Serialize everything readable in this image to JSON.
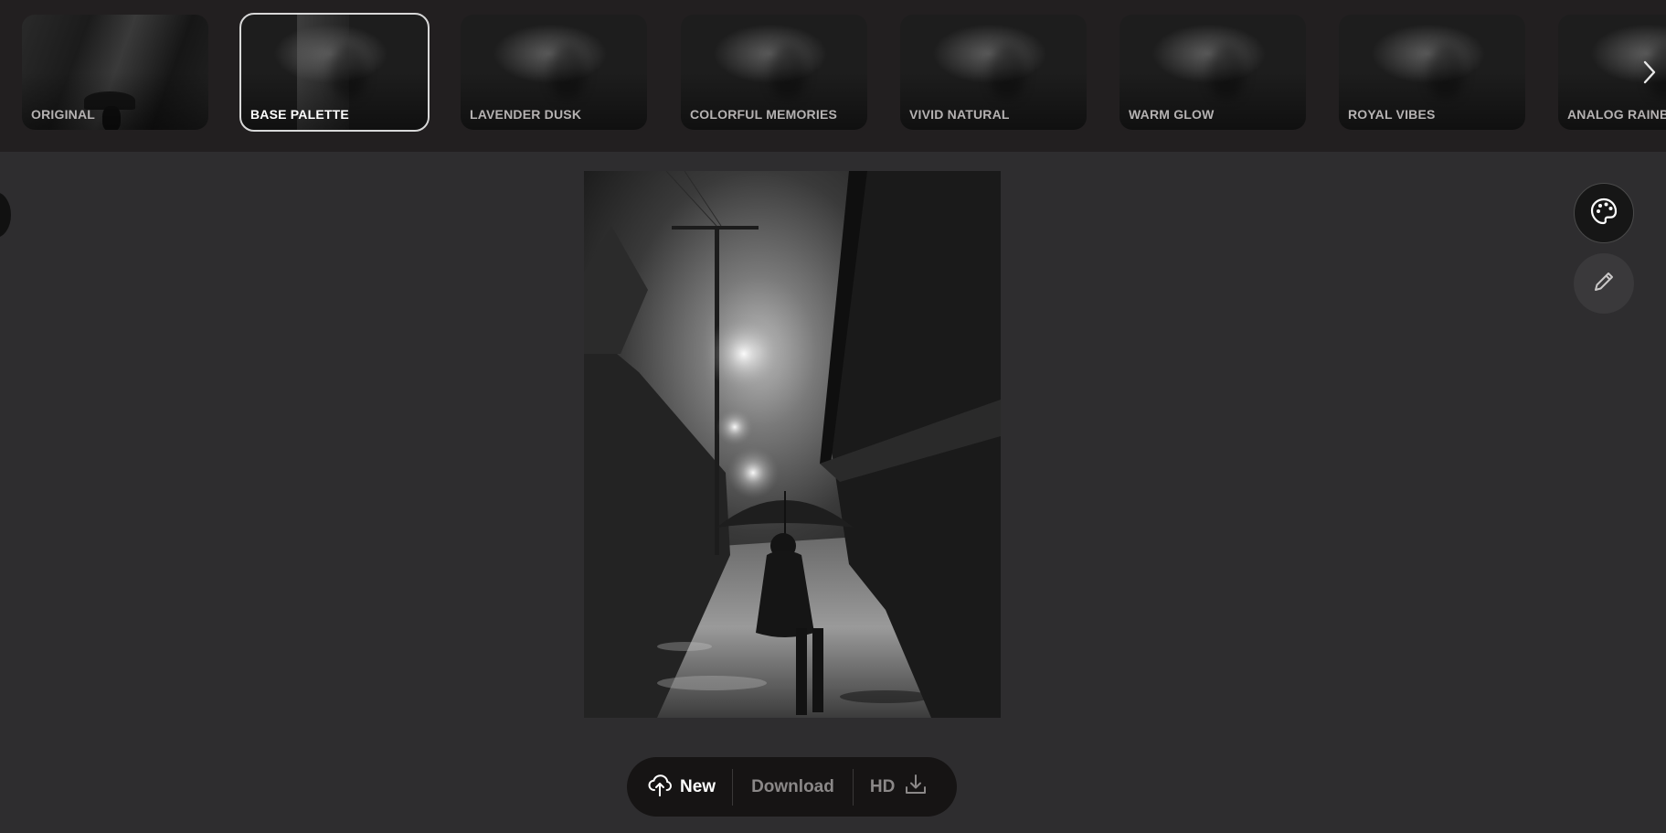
{
  "filters": [
    {
      "label": "ORIGINAL",
      "active": false
    },
    {
      "label": "BASE PALETTE",
      "active": true
    },
    {
      "label": "LAVENDER DUSK",
      "active": false
    },
    {
      "label": "COLORFUL MEMORIES",
      "active": false
    },
    {
      "label": "VIVID NATURAL",
      "active": false
    },
    {
      "label": "WARM GLOW",
      "active": false
    },
    {
      "label": "ROYAL VIBES",
      "active": false
    },
    {
      "label": "ANALOG RAINBO",
      "active": false
    }
  ],
  "icons": {
    "next": "chevron-right-icon",
    "palette": "palette-icon",
    "edit": "pencil-icon",
    "upload": "cloud-upload-icon",
    "download": "download-icon"
  },
  "actions": {
    "new_label": "New",
    "download_label": "Download",
    "hd_label": "HD"
  },
  "colors": {
    "background": "#2e2d2f",
    "strip": "#221f20",
    "action_bar": "#161414",
    "muted_text": "#8b8888"
  }
}
